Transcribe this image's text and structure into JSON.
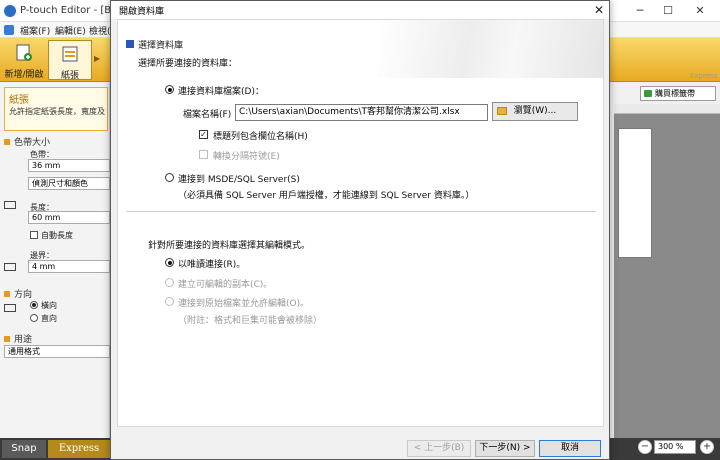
{
  "app": {
    "title": "P-touch Editor - [BIN BC",
    "menus": [
      "檔案(F)",
      "編輯(E)",
      "檢視("
    ],
    "ribbon_tabs": [
      {
        "label": "新增/開啟",
        "icon": "new-open-icon"
      },
      {
        "label": "紙張",
        "icon": "paper-icon"
      }
    ],
    "express_label": "Express",
    "buy_button": "購買標籤帶",
    "left_panel": {
      "note_title": "紙張",
      "note_text": "允許指定紙張長度，寬度及",
      "tape_section": "色帶大小",
      "tape_label": "色帶：",
      "tape_value": "36 mm",
      "detect_value": "偵測尺寸和顏色",
      "length_label": "長度：",
      "length_value": "60 mm",
      "auto_length": "自動長度",
      "margin_label": "邊界：",
      "margin_value": "4 mm",
      "orientation_section": "方向",
      "landscape": "橫向",
      "portrait": "直向",
      "usage_section": "用途",
      "usage_value": "通用格式"
    },
    "status": {
      "snap": "Snap",
      "express": "Express",
      "zoom": "300 %"
    }
  },
  "dialog": {
    "title": "開啟資料庫",
    "close_glyph": "✕",
    "section_title": "選擇資料庫",
    "prompt": "選擇所要連接的資料庫：",
    "option_file": "連接資料庫檔案(D)：",
    "file_name_label": "檔案名稱(F)",
    "file_path": "C:\\Users\\axian\\Documents\\T客邦幫你清潔公司.xlsx",
    "browse_label": "瀏覽(W)...",
    "header_row_option": "標題列包含欄位名稱(H)",
    "convert_option": "轉換分隔符號(E)",
    "option_sql": "連接到 MSDE/SQL Server(S)",
    "sql_note": "（必須具備 SQL Server 用戶端授權，才能連線到 SQL Server 資料庫。）",
    "mode_prompt": "針對所要連接的資料庫選擇其編輯模式。",
    "mode_readonly": "以唯讀連接(R)。",
    "mode_copy": "建立可編輯的副本(C)。",
    "mode_edit_original": "連接到原始檔案並允許編輯(O)。",
    "mode_note": "（附註：格式和巨集可能會被移除）",
    "btn_back": "< 上一步(B)",
    "btn_next": "下一步(N) >",
    "btn_cancel": "取消"
  }
}
